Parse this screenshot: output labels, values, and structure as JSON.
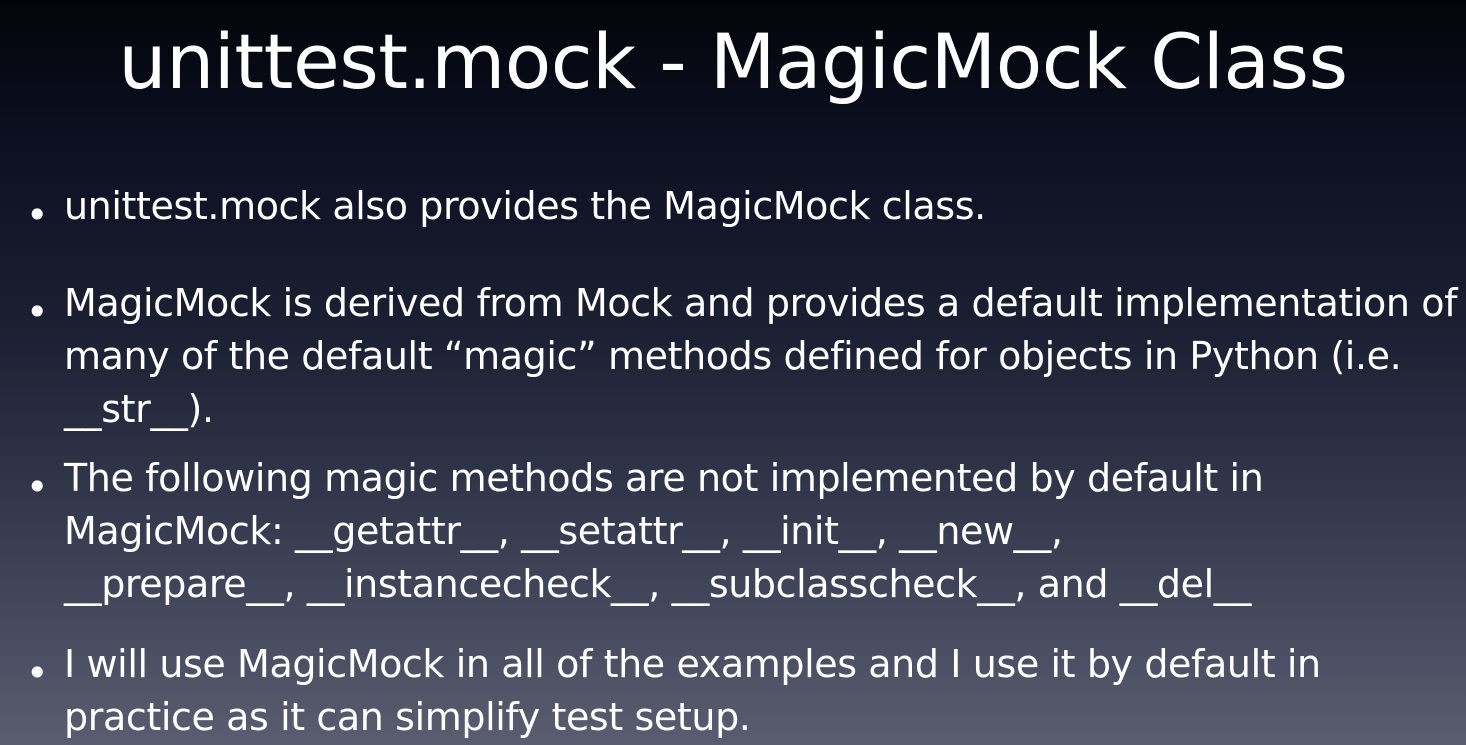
{
  "slide": {
    "title": "unittest.mock - MagicMock Class",
    "bullets": [
      {
        "text": "unittest.mock also provides the MagicMock class."
      },
      {
        "text": "MagicMock is derived from Mock and provides a default implementation of\nmany of the default “magic” methods defined for objects in Python (i.e.\n__str__)."
      },
      {
        "text": "The following magic methods are not implemented by default in\nMagicMock: __getattr__, __setattr__, __init__, __new__,\n__prepare__, __instancecheck__, __subclasscheck__, and __del__"
      },
      {
        "text": "I will use MagicMock in all of the examples and I use it by default in\npractice as it can simplify test setup."
      }
    ],
    "bullet_glyph": "•"
  },
  "colors": {
    "background_top": "#030509",
    "background_bottom": "#5a5d6f",
    "text": "#ffffff"
  }
}
